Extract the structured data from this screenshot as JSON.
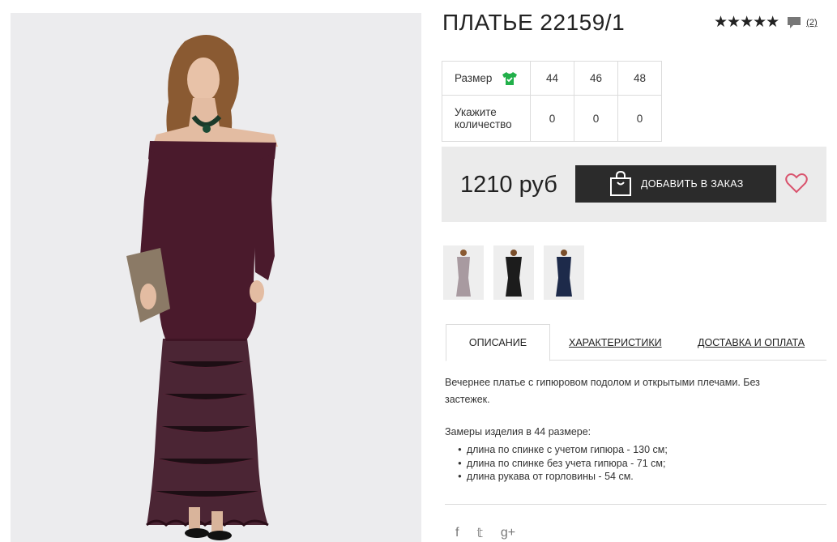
{
  "product": {
    "title": "ПЛАТЬЕ 22159/1",
    "rating_stars": "★★★★★",
    "review_count": "(2)"
  },
  "sizes": {
    "size_label": "Размер",
    "values": [
      "44",
      "46",
      "48"
    ],
    "qty_label": "Укажите количество",
    "quantities": [
      "0",
      "0",
      "0"
    ]
  },
  "purchase": {
    "price": "1210 руб",
    "add_button": "ДОБАВИТЬ В ЗАКАЗ"
  },
  "tabs": {
    "description": "ОПИСАНИЕ",
    "specs": "ХАРАКТЕРИСТИКИ",
    "delivery": "ДОСТАВКА И ОПЛАТА"
  },
  "description": {
    "text": "Вечернее платье с гипюровом подолом и открытыми плечами. Без застежек.",
    "measure_title": "Замеры изделия в 44 размере:",
    "measures": [
      "длина по спинке с учетом гипюра - 130 см;",
      "длина по спинке без учета гипюра - 71 см;",
      "длина рукава от горловины - 54 см."
    ]
  },
  "social": {
    "facebook": "f",
    "twitter": "𝕥",
    "googleplus": "g+"
  },
  "colors": {
    "dress": "#4a1a2c",
    "button": "#2b2b2b",
    "shirt_icon": "#22b04a",
    "heart": "#d9536d",
    "price_box": "#ebebeb"
  },
  "icons": [
    "comment-icon",
    "shirt-icon",
    "bag-icon",
    "heart-icon",
    "facebook-icon",
    "twitter-icon",
    "googleplus-icon"
  ]
}
